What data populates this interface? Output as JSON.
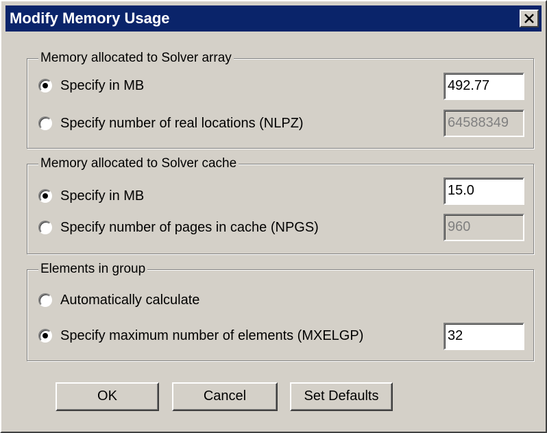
{
  "window": {
    "title": "Modify Memory Usage"
  },
  "array_group": {
    "legend": "Memory allocated to Solver array",
    "option_mb": {
      "label": "Specify in MB",
      "checked": true,
      "value": "492.77"
    },
    "option_nlpz": {
      "label": "Specify number of real locations (NLPZ)",
      "checked": false,
      "value": "64588349"
    }
  },
  "cache_group": {
    "legend": "Memory allocated to Solver cache",
    "option_mb": {
      "label": "Specify in MB",
      "checked": true,
      "value": "15.0"
    },
    "option_npgs": {
      "label": "Specify number of pages in cache (NPGS)",
      "checked": false,
      "value": "960"
    }
  },
  "elements_group": {
    "legend": "Elements in group",
    "option_auto": {
      "label": "Automatically calculate",
      "checked": false
    },
    "option_max": {
      "label": "Specify maximum number of elements (MXELGP)",
      "checked": true,
      "value": "32"
    }
  },
  "buttons": {
    "ok": "OK",
    "cancel": "Cancel",
    "defaults": "Set Defaults"
  },
  "colors": {
    "titlebar": "#0a246a",
    "face": "#d4d0c8",
    "disabled_text": "#808080"
  }
}
